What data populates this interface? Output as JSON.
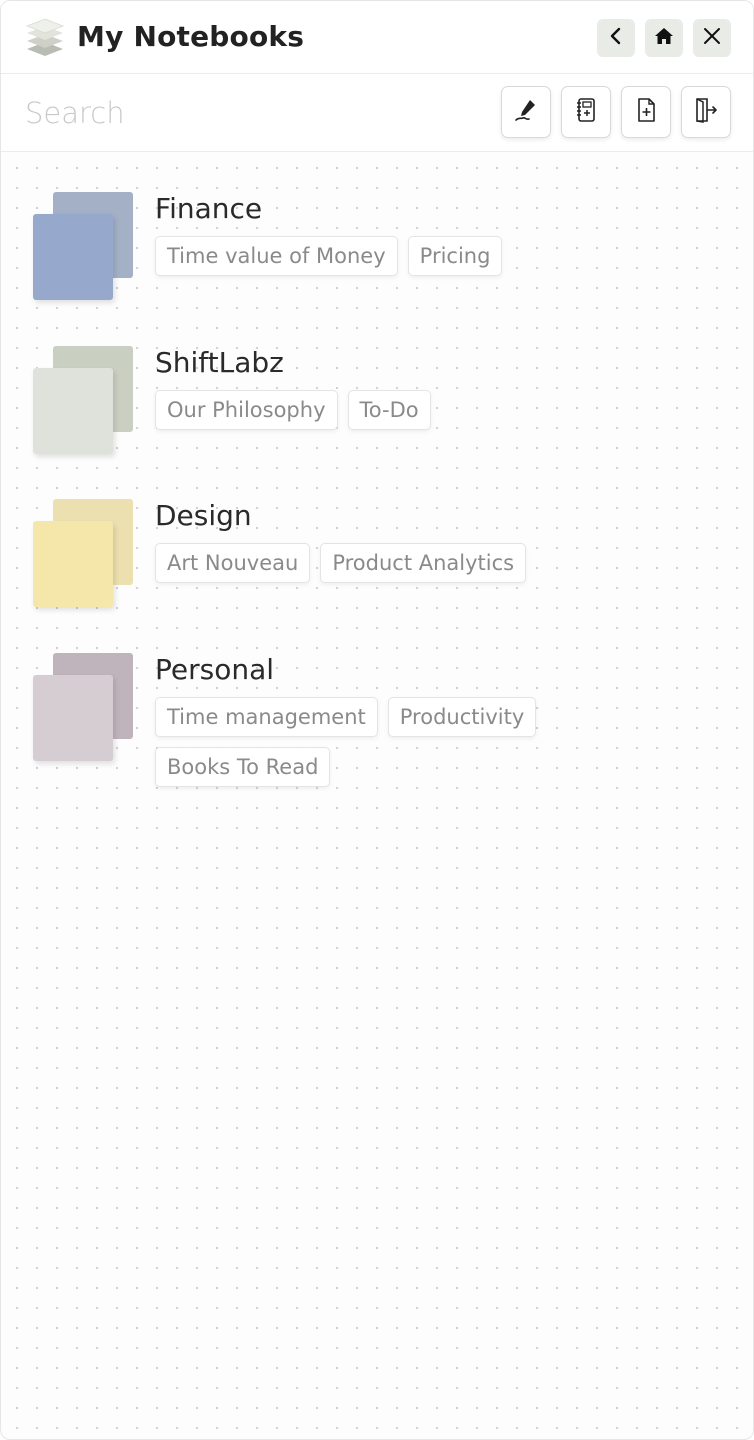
{
  "header": {
    "title": "My Notebooks",
    "logo_icon": "layers-stack-icon",
    "buttons": [
      {
        "name": "back-button",
        "icon": "chevron-left-icon"
      },
      {
        "name": "home-button",
        "icon": "home-icon"
      },
      {
        "name": "close-button",
        "icon": "close-icon"
      }
    ]
  },
  "search": {
    "placeholder": "Search",
    "value": ""
  },
  "toolbar": {
    "buttons": [
      {
        "name": "edit-button",
        "icon": "pen-icon"
      },
      {
        "name": "new-notebook-button",
        "icon": "notebook-icon"
      },
      {
        "name": "new-page-button",
        "icon": "file-plus-icon"
      },
      {
        "name": "exit-button",
        "icon": "exit-door-icon"
      }
    ]
  },
  "colors": {
    "header_button_bg": "#e9ebe6",
    "dot_grid": "#cfcfcf",
    "tag_text": "#8a8a8a"
  },
  "notebooks": [
    {
      "name": "Finance",
      "color_back": "#a3b0c6",
      "color_front": "#96a9cc",
      "tags": [
        "Time value of Money",
        "Pricing"
      ]
    },
    {
      "name": "ShiftLabz",
      "color_back": "#c9cfc1",
      "color_front": "#dfe2da",
      "tags": [
        "Our Philosophy",
        "To-Do"
      ]
    },
    {
      "name": "Design",
      "color_back": "#ede0b0",
      "color_front": "#f5e7a9",
      "tags": [
        "Art Nouveau",
        "Product Analytics"
      ]
    },
    {
      "name": "Personal",
      "color_back": "#bfb4bb",
      "color_front": "#d5cdd2",
      "tags": [
        "Time management",
        "Productivity",
        "Books To Read"
      ]
    }
  ]
}
